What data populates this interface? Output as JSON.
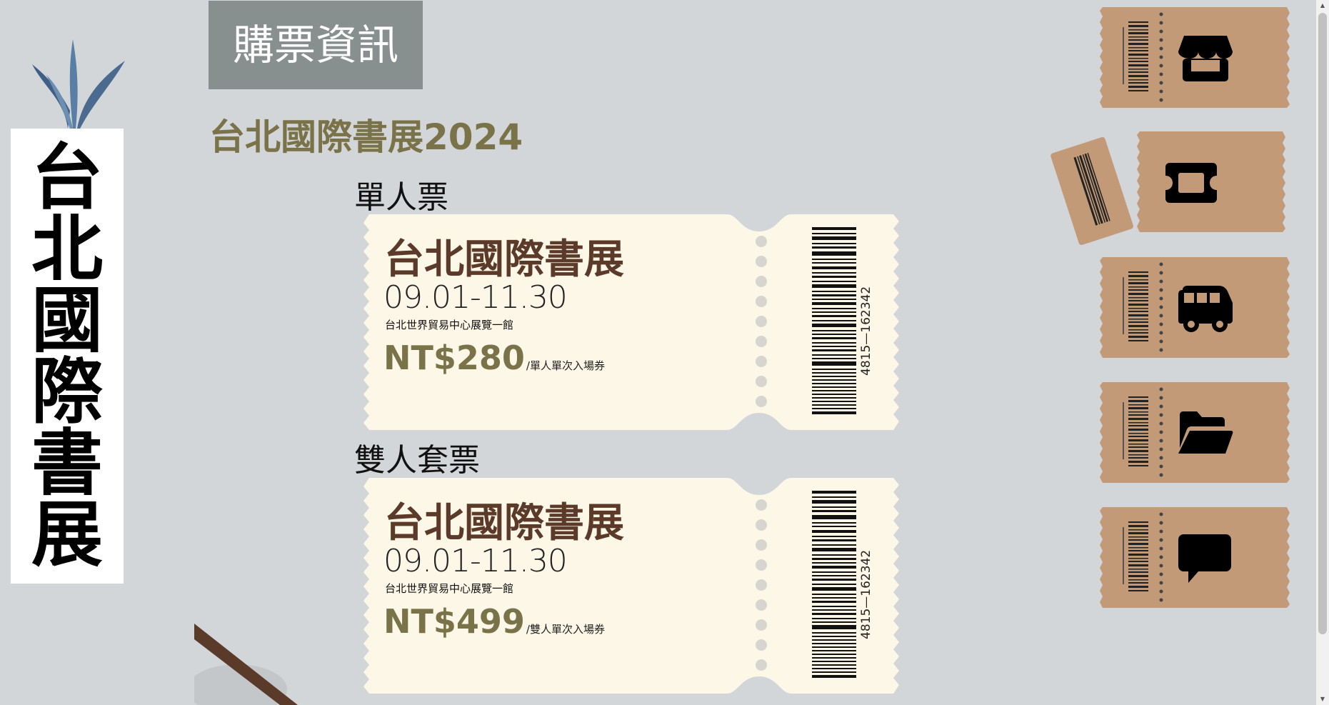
{
  "banner": {
    "chars": [
      "台",
      "北",
      "國",
      "際",
      "書",
      "展"
    ]
  },
  "header": {
    "title": "購票資訊"
  },
  "event": {
    "title": "台北國際書展2024"
  },
  "tickets": [
    {
      "section_label": "單人票",
      "name": "台北國際書展",
      "dates": "09.01-11.30",
      "venue": "台北世界貿易中心展覽一館",
      "price": "NT$280",
      "price_note": "/單人單次入場券",
      "serial": "4815—162342"
    },
    {
      "section_label": "雙人套票",
      "name": "台北國際書展",
      "dates": "09.01-11.30",
      "venue": "台北世界貿易中心展覽一館",
      "price": "NT$499",
      "price_note": "/雙人單次入場券",
      "serial": "4815—162342"
    }
  ],
  "nav": [
    {
      "icon": "store-icon"
    },
    {
      "icon": "ticket-icon"
    },
    {
      "icon": "bus-icon"
    },
    {
      "icon": "folder-open-icon"
    },
    {
      "icon": "chat-bubble-icon"
    }
  ],
  "colors": {
    "background": "#d3d6d9",
    "ticket": "#fdf7e7",
    "nav_tab": "#c29a78",
    "accent_olive": "#7a7248",
    "ticket_title": "#5c3a29",
    "header_block": "#888f8f"
  }
}
